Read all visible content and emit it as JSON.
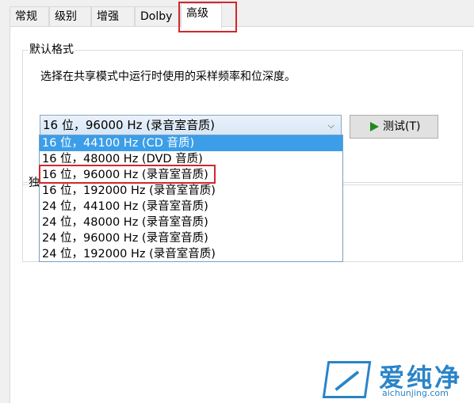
{
  "tabs": [
    {
      "label": "常规"
    },
    {
      "label": "级别"
    },
    {
      "label": "增强"
    },
    {
      "label": "Dolby"
    },
    {
      "label": "高级",
      "active": true
    }
  ],
  "default_format": {
    "group_label": "默认格式",
    "description": "选择在共享模式中运行时使用的采样频率和位深度。",
    "selected_value": "16 位，96000 Hz (录音室音质)",
    "test_button_label": "测试(T)",
    "options": [
      "16 位，44100 Hz (CD 音质)",
      "16 位，48000 Hz (DVD 音质)",
      "16 位，96000 Hz (录音室音质)",
      "16 位，192000 Hz (录音室音质)",
      "24 位，44100 Hz (录音室音质)",
      "24 位，48000 Hz (录音室音质)",
      "24 位，96000 Hz (录音室音质)",
      "24 位，192000 Hz (录音室音质)"
    ],
    "highlighted_option_index": 0
  },
  "exclusive_group_label_partial": "独",
  "watermark": {
    "name": "爱纯净",
    "url": "aichunjing.com"
  },
  "colors": {
    "highlight_red": "#d0282e",
    "selection_blue": "#3c9ee8",
    "watermark_blue": "#2a84c8"
  }
}
